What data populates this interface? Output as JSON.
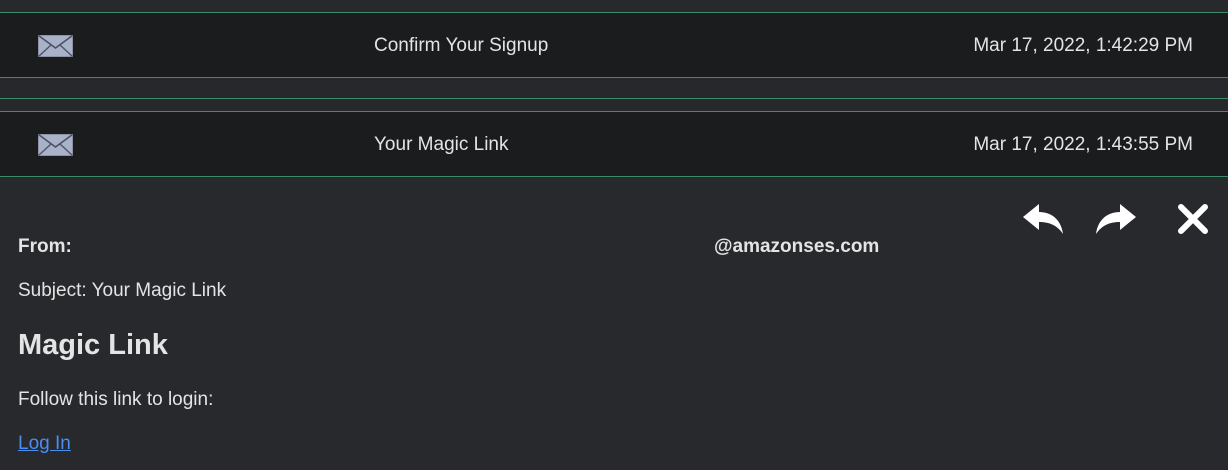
{
  "inbox": {
    "messages": [
      {
        "icon": "envelope-icon",
        "subject": "Confirm Your Signup",
        "date": "Mar 17, 2022, 1:42:29 PM"
      },
      {
        "icon": "envelope-icon",
        "subject": "Your Magic Link",
        "date": "Mar 17, 2022, 1:43:55 PM"
      }
    ]
  },
  "detail": {
    "actions": [
      {
        "icon": "reply-icon"
      },
      {
        "icon": "forward-icon"
      },
      {
        "icon": "close-icon"
      }
    ],
    "from_label": "From:",
    "from_value": "@amazonses.com",
    "subject_line": "Subject: Your Magic Link",
    "heading": "Magic Link",
    "body_text": "Follow this link to login:",
    "link_text": "Log In"
  },
  "colors": {
    "row_background": "#1b1c1e",
    "page_background": "#27292d",
    "divider": "#3c8c6c",
    "text": "#e4e4e4",
    "link": "#4a8ef0"
  }
}
